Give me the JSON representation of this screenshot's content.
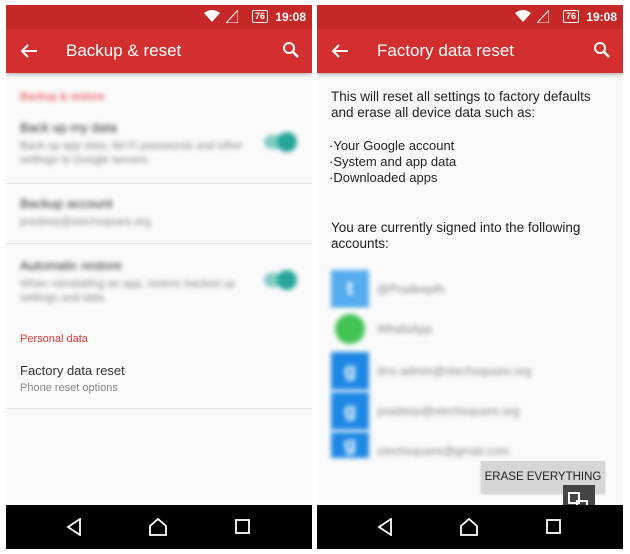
{
  "status": {
    "battery": "76",
    "time": "19:08"
  },
  "left": {
    "title": "Backup & reset",
    "sections": [
      {
        "header": "Backup & restore"
      },
      {
        "header": "Personal data"
      }
    ],
    "items": [
      {
        "title": "Back up my data",
        "subtitle": "Back up app data, Wi-Fi passwords and other settings to Google servers"
      },
      {
        "title": "Backup account",
        "subtitle": "pradeep@stechsquare.org"
      },
      {
        "title": "Automatic restore",
        "subtitle": "When reinstalling an app, restore backed up settings and data"
      },
      {
        "title": "Factory data reset",
        "subtitle": "Phone reset options"
      }
    ]
  },
  "right": {
    "title": "Factory data reset",
    "intro": "This will reset all settings to factory defaults and erase all device data such as:",
    "bullets": [
      "Your Google account",
      "System and app data",
      "Downloaded apps"
    ],
    "signed_in": "You are currently signed into the following accounts:",
    "accounts": [
      {
        "icon": "twitter-icon",
        "text": "@Pradeepth"
      },
      {
        "icon": "whatsapp-icon",
        "text": "WhatsApp"
      },
      {
        "icon": "google-account-icon",
        "text": "dns-admin@stechsquare.org"
      },
      {
        "icon": "google-account-icon",
        "text": "pradeep@stechsquare.org"
      },
      {
        "icon": "google-account-icon",
        "text": "stechsquare@gmail.com"
      }
    ],
    "erase_button": "ERASE EVERYTHING"
  },
  "colors": {
    "appbar": "#d32f2f",
    "statusbar": "#c62828",
    "accent": "#26a69a",
    "section_header": "#e53935"
  }
}
